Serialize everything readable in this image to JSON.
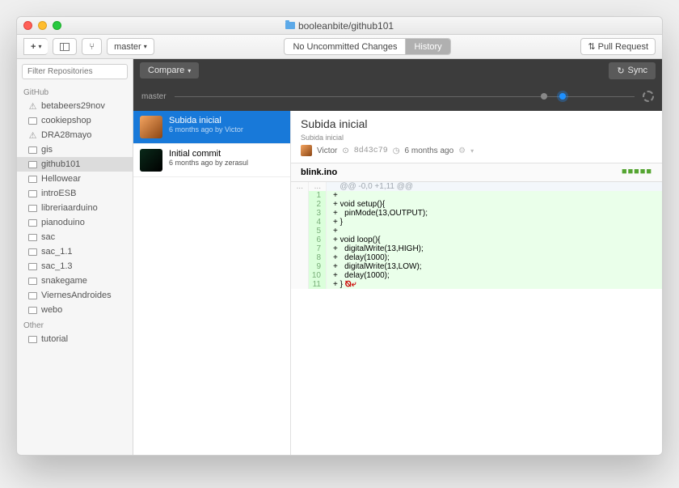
{
  "window": {
    "title": "booleanbite/github101"
  },
  "toolbar": {
    "branch_selector": "master",
    "no_changes": "No Uncommitted Changes",
    "history": "History",
    "pull_request": "Pull Request"
  },
  "sidebar": {
    "filter_placeholder": "Filter Repositories",
    "sections": [
      {
        "header": "GitHub",
        "items": [
          {
            "label": "betabeers29nov",
            "icon": "warn"
          },
          {
            "label": "cookiepshop",
            "icon": "repo"
          },
          {
            "label": "DRA28mayo",
            "icon": "warn"
          },
          {
            "label": "gis",
            "icon": "repo"
          },
          {
            "label": "github101",
            "icon": "repo",
            "selected": true
          },
          {
            "label": "Hellowear",
            "icon": "repo"
          },
          {
            "label": "introESB",
            "icon": "repo"
          },
          {
            "label": "libreriaarduino",
            "icon": "repo"
          },
          {
            "label": "pianoduino",
            "icon": "repo"
          },
          {
            "label": "sac",
            "icon": "repo"
          },
          {
            "label": "sac_1.1",
            "icon": "repo"
          },
          {
            "label": "sac_1.3",
            "icon": "repo"
          },
          {
            "label": "snakegame",
            "icon": "repo"
          },
          {
            "label": "ViernesAndroides",
            "icon": "repo"
          },
          {
            "label": "webo",
            "icon": "repo"
          }
        ]
      },
      {
        "header": "Other",
        "items": [
          {
            "label": "tutorial",
            "icon": "repo"
          }
        ]
      }
    ]
  },
  "darkbar": {
    "compare": "Compare",
    "sync": "Sync"
  },
  "timeline": {
    "branch": "master"
  },
  "commits": [
    {
      "title": "Subida inicial",
      "meta": "6 months ago by Victor",
      "selected": true,
      "avatar": "av1"
    },
    {
      "title": "Initial commit",
      "meta": "6 months ago by zerasul",
      "selected": false,
      "avatar": "av2"
    }
  ],
  "detail": {
    "title": "Subida inicial",
    "subtitle": "Subida inicial",
    "author": "Victor",
    "sha": "8d43c79",
    "time": "6 months ago",
    "file": "blink.ino",
    "churn": "■■■■■",
    "hunk": "@@ -0,0 +1,11 @@",
    "lines": [
      {
        "n": "1",
        "text": "+"
      },
      {
        "n": "2",
        "text": "+ void setup(){"
      },
      {
        "n": "3",
        "text": "+   pinMode(13,OUTPUT);"
      },
      {
        "n": "4",
        "text": "+ }"
      },
      {
        "n": "5",
        "text": "+"
      },
      {
        "n": "6",
        "text": "+ void loop(){"
      },
      {
        "n": "7",
        "text": "+   digitalWrite(13,HIGH);"
      },
      {
        "n": "8",
        "text": "+   delay(1000);"
      },
      {
        "n": "9",
        "text": "+   digitalWrite(13,LOW);"
      },
      {
        "n": "10",
        "text": "+   delay(1000);"
      },
      {
        "n": "11",
        "text": "+ }",
        "eof": true
      }
    ]
  }
}
